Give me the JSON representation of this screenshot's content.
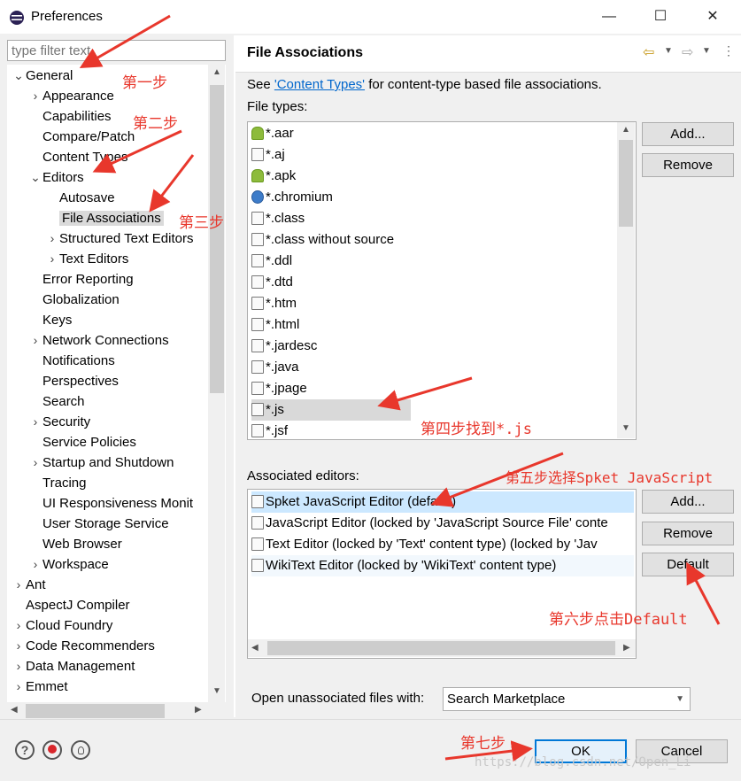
{
  "window": {
    "title": "Preferences",
    "min": "—",
    "max": "☐",
    "close": "✕"
  },
  "filter": {
    "placeholder": "type filter text"
  },
  "tree": [
    {
      "label": "General",
      "level": 0,
      "twisty": "v"
    },
    {
      "label": "Appearance",
      "level": 1,
      "twisty": ">"
    },
    {
      "label": "Capabilities",
      "level": 1,
      "twisty": ""
    },
    {
      "label": "Compare/Patch",
      "level": 1,
      "twisty": ""
    },
    {
      "label": "Content Types",
      "level": 1,
      "twisty": ""
    },
    {
      "label": "Editors",
      "level": 1,
      "twisty": "v"
    },
    {
      "label": "Autosave",
      "level": 2,
      "twisty": ""
    },
    {
      "label": "File Associations",
      "level": 2,
      "twisty": "",
      "selected": true
    },
    {
      "label": "Structured Text Editors",
      "level": 2,
      "twisty": ">"
    },
    {
      "label": "Text Editors",
      "level": 2,
      "twisty": ">"
    },
    {
      "label": "Error Reporting",
      "level": 1,
      "twisty": ""
    },
    {
      "label": "Globalization",
      "level": 1,
      "twisty": ""
    },
    {
      "label": "Keys",
      "level": 1,
      "twisty": ""
    },
    {
      "label": "Network Connections",
      "level": 1,
      "twisty": ">"
    },
    {
      "label": "Notifications",
      "level": 1,
      "twisty": ""
    },
    {
      "label": "Perspectives",
      "level": 1,
      "twisty": ""
    },
    {
      "label": "Search",
      "level": 1,
      "twisty": ""
    },
    {
      "label": "Security",
      "level": 1,
      "twisty": ">"
    },
    {
      "label": "Service Policies",
      "level": 1,
      "twisty": ""
    },
    {
      "label": "Startup and Shutdown",
      "level": 1,
      "twisty": ">"
    },
    {
      "label": "Tracing",
      "level": 1,
      "twisty": ""
    },
    {
      "label": "UI Responsiveness Monit",
      "level": 1,
      "twisty": ""
    },
    {
      "label": "User Storage Service",
      "level": 1,
      "twisty": ""
    },
    {
      "label": "Web Browser",
      "level": 1,
      "twisty": ""
    },
    {
      "label": "Workspace",
      "level": 1,
      "twisty": ">"
    },
    {
      "label": "Ant",
      "level": 0,
      "twisty": ">"
    },
    {
      "label": "AspectJ Compiler",
      "level": 0,
      "twisty": ""
    },
    {
      "label": "Cloud Foundry",
      "level": 0,
      "twisty": ">"
    },
    {
      "label": "Code Recommenders",
      "level": 0,
      "twisty": ">"
    },
    {
      "label": "Data Management",
      "level": 0,
      "twisty": ">"
    },
    {
      "label": "Emmet",
      "level": 0,
      "twisty": ">"
    }
  ],
  "page": {
    "title": "File Associations",
    "intro_prefix": "See ",
    "intro_link": "'Content Types'",
    "intro_suffix": " for content-type based file associations.",
    "file_types_label": "File types:",
    "file_types": [
      {
        "name": "*.aar",
        "icon": "android"
      },
      {
        "name": "*.aj",
        "icon": "aspectj"
      },
      {
        "name": "*.apk",
        "icon": "android"
      },
      {
        "name": "*.chromium",
        "icon": "globe"
      },
      {
        "name": "*.class",
        "icon": "class"
      },
      {
        "name": "*.class without source",
        "icon": "class"
      },
      {
        "name": "*.ddl",
        "icon": "file"
      },
      {
        "name": "*.dtd",
        "icon": "file"
      },
      {
        "name": "*.htm",
        "icon": "file"
      },
      {
        "name": "*.html",
        "icon": "file"
      },
      {
        "name": "*.jardesc",
        "icon": "file"
      },
      {
        "name": "*.java",
        "icon": "java"
      },
      {
        "name": "*.jpage",
        "icon": "file"
      },
      {
        "name": "*.js",
        "icon": "file",
        "selected": true
      },
      {
        "name": "*.jsf",
        "icon": "file"
      }
    ],
    "file_buttons": {
      "add": "Add...",
      "remove": "Remove"
    },
    "editors_label": "Associated editors:",
    "editors": [
      "Spket JavaScript Editor (default)",
      "JavaScript Editor (locked by 'JavaScript Source File' conte",
      "Text Editor (locked by 'Text' content type) (locked by 'Jav",
      "WikiText Editor (locked by 'WikiText' content type)"
    ],
    "editor_buttons": {
      "add": "Add...",
      "remove": "Remove",
      "default": "Default"
    },
    "unassociated_label": "Open unassociated files with:",
    "unassociated_value": "Search Marketplace"
  },
  "footer": {
    "ok": "OK",
    "cancel": "Cancel",
    "help_icon": "?",
    "watermark": "https://blog.csdn.net/Open_Li"
  },
  "annotations": {
    "step1": "第一步",
    "step2": "第二步",
    "step3": "第三步",
    "step4": "第四步找到*.js",
    "step5": "第五步选择Spket JavaScript",
    "step6": "第六步点击Default",
    "step7": "第七步"
  },
  "colors": {
    "annotation": "#e8372c",
    "link": "#0066cc",
    "selection": "#cce8ff",
    "primary_border": "#0078d7"
  }
}
